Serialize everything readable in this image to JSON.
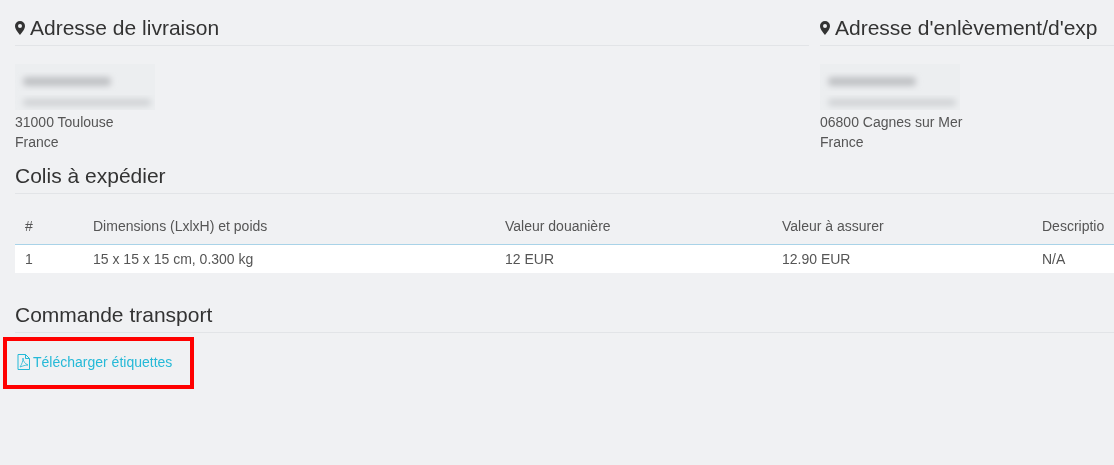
{
  "addresses": [
    {
      "title": "Adresse de livraison",
      "lines": [
        "31000 Toulouse",
        "France"
      ]
    },
    {
      "title": "Adresse d'enlèvement/d'exp",
      "lines": [
        "06800 Cagnes sur Mer",
        "France"
      ]
    }
  ],
  "parcels": {
    "title": "Colis à expédier",
    "columns": [
      "#",
      "Dimensions (LxlxH) et poids",
      "Valeur douanière",
      "Valeur à assurer",
      "Descriptio"
    ],
    "rows": [
      [
        "1",
        "15 x 15 x 15 cm, 0.300 kg",
        "12 EUR",
        "12.90 EUR",
        "N/A"
      ]
    ]
  },
  "transport": {
    "title": "Commande transport",
    "link": "Télécharger étiquettes",
    "highlighted": true
  }
}
